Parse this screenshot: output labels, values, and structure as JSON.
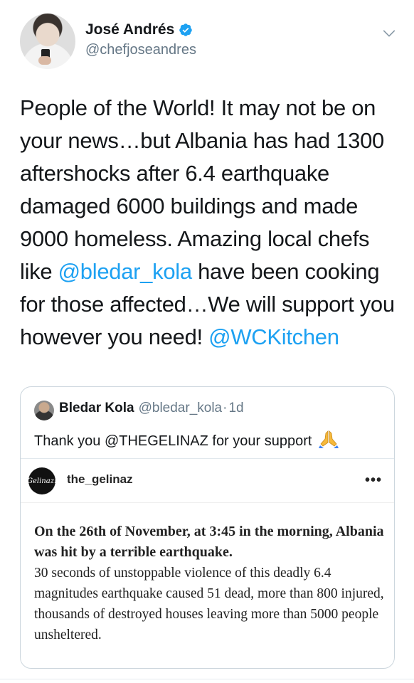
{
  "author": {
    "display_name": "José Andrés",
    "handle": "@chefjoseandres",
    "verified_icon": "verified-badge-icon",
    "verified_color": "#1da1f2"
  },
  "tweet": {
    "text_parts": [
      {
        "text": "People of the World! It may not be on your news…but Albania has had 1300 aftershocks after 6.4 earthquake damaged 6000 buildings and made 9000 homeless. Amazing local chefs like ",
        "mention": false
      },
      {
        "text": "@bledar_kola",
        "mention": true
      },
      {
        "text": " have been cooking for those affected…We will support you however you need! ",
        "mention": false
      },
      {
        "text": "@WCKitchen",
        "mention": true
      }
    ]
  },
  "quoted_tweet": {
    "name": "Bledar Kola",
    "handle": "@bledar_kola",
    "separator": "·",
    "time": "1d",
    "text": "Thank you @THEGELINAZ for your support",
    "emoji_icon": "folded-hands-icon"
  },
  "instagram_embed": {
    "logo_text": "Gelinaz!",
    "username": "the_gelinaz",
    "more_label": "•••",
    "headline": "On the 26th of November, at 3:45 in the morning, Albania was hit by a terrible earthquake.",
    "body": "30 seconds of unstoppable violence of this deadly 6.4 magnitudes earthquake caused 51 dead, more than 800 injured, thousands of destroyed houses leaving more than 5000 people unsheltered."
  },
  "colors": {
    "mention": "#1da1f2",
    "secondary_text": "#657786",
    "border": "#ccd6dd"
  }
}
